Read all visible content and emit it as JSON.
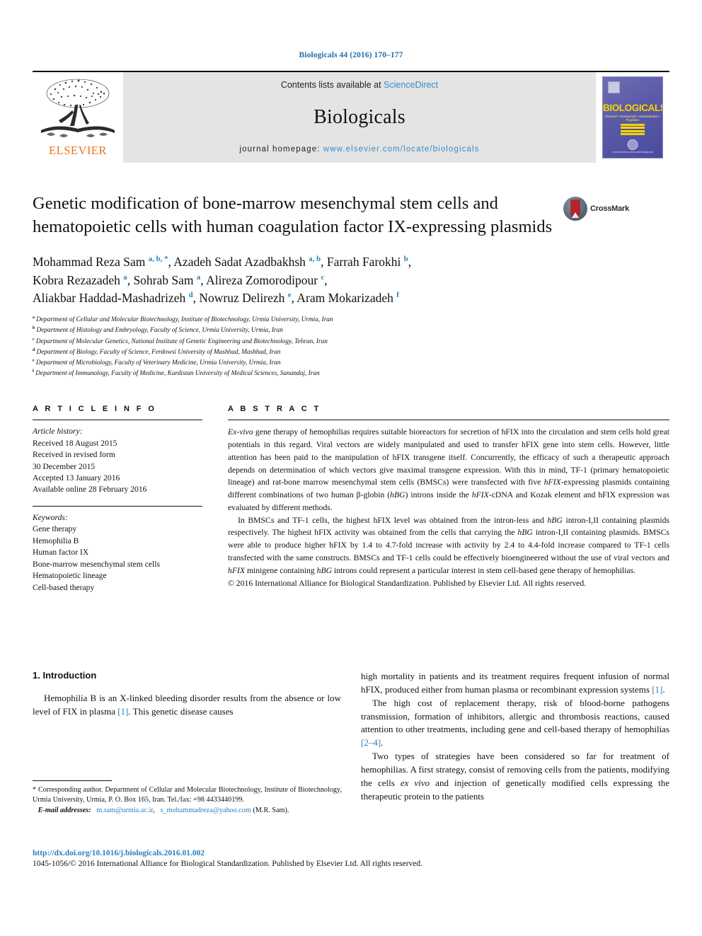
{
  "running_head": "Biologicals 44 (2016) 170–177",
  "masthead": {
    "contents_prefix": "Contents lists available at ",
    "contents_link": "ScienceDirect",
    "journal_name": "Biologicals",
    "homepage_prefix": "journal homepage: ",
    "homepage_url": "www.elsevier.com/locate/biologicals",
    "publisher": "ELSEVIER",
    "cover": {
      "title": "BIOLOGICALS",
      "subtitle": "Research • Development • Standardisation • Regulation",
      "footer": "www.elsevier.com/locate/biologicals"
    }
  },
  "article": {
    "title": "Genetic modification of bone-marrow mesenchymal stem cells and hematopoietic cells with human coagulation factor IX-expressing plasmids",
    "crossmark_label": "CrossMark",
    "authors_html": "Mohammad Reza Sam <sup>a, b, *</sup>, Azadeh Sadat Azadbakhsh <sup>a, b</sup>, Farrah Farokhi <sup>b</sup>,<br>Kobra Rezazadeh <sup>a</sup>, Sohrab Sam <sup>a</sup>, Alireza Zomorodipour <sup>c</sup>,<br>Aliakbar Haddad-Mashadrizeh <sup>d</sup>, Nowruz Delirezh <sup>e</sup>, Aram Mokarizadeh <sup>f</sup>",
    "affiliations": [
      {
        "mark": "a",
        "text": "Department of Cellular and Molecular Biotechnology, Institute of Biotechnology, Urmia University, Urmia, Iran"
      },
      {
        "mark": "b",
        "text": "Department of Histology and Embryology, Faculty of Science, Urmia University, Urmia, Iran"
      },
      {
        "mark": "c",
        "text": "Department of Molecular Genetics, National Institute of Genetic Engineering and Biotechnology, Tehran, Iran"
      },
      {
        "mark": "d",
        "text": "Department of Biology, Faculty of Science, Ferdowsi University of Mashhad, Mashhad, Iran"
      },
      {
        "mark": "e",
        "text": "Department of Microbiology, Faculty of Veterinary Medicine, Urmia University, Urmia, Iran"
      },
      {
        "mark": "f",
        "text": "Department of Immunology, Faculty of Medicine, Kurdistan University of Medical Sciences, Sanandaj, Iran"
      }
    ]
  },
  "article_info": {
    "heading": "A R T I C L E   I N F O",
    "history_label": "Article history:",
    "history": [
      "Received 18 August 2015",
      "Received in revised form",
      "30 December 2015",
      "Accepted 13 January 2016",
      "Available online 28 February 2016"
    ],
    "keywords_label": "Keywords:",
    "keywords": [
      "Gene therapy",
      "Hemophilia B",
      "Human factor IX",
      "Bone-marrow mesenchymal stem cells",
      "Hematopoietic lineage",
      "Cell-based therapy"
    ]
  },
  "abstract": {
    "heading": "A B S T R A C T",
    "paragraph1_html": "<i>Ex-vivo</i> gene therapy of hemophilias requires suitable bioreactors for secretion of hFIX into the circulation and stem cells hold great potentials in this regard. Viral vectors are widely manipulated and used to transfer hFIX gene into stem cells. However, little attention has been paid to the manipulation of hFIX transgene itself. Concurrently, the efficacy of such a therapeutic approach depends on determination of which vectors give maximal transgene expression. With this in mind, TF-1 (primary hematopoietic lineage) and rat-bone marrow mesenchymal stem cells (BMSCs) were transfected with five <i>hFIX</i>-expressing plasmids containing different combinations of two human β-globin (<i>hBG</i>) introns inside the <i>hFIX</i>-cDNA and Kozak element and hFIX expression was evaluated by different methods.",
    "paragraph2_html": "In BMSCs and TF-1 cells, the highest hFIX level was obtained from the intron-less and <i>hBG</i> intron-I,II containing plasmids respectively. The highest hFIX activity was obtained from the cells that carrying the <i>hBG</i> intron-I,II containing plasmids. BMSCs were able to produce higher hFIX by 1.4 to 4.7-fold increase with activity by 2.4 to 4.4-fold increase compared to TF-1 cells transfected with the same constructs. BMSCs and TF-1 cells could be effectively bioengineered without the use of viral vectors and <i>hFIX</i> minigene containing <i>hBG</i> introns could represent a particular interest in stem cell-based gene therapy of hemophilias.",
    "copyright": "© 2016 International Alliance for Biological Standardization. Published by Elsevier Ltd. All rights reserved."
  },
  "introduction": {
    "section_title": "1. Introduction",
    "left_paragraph_html": "Hemophilia B is an X-linked bleeding disorder results from the absence or low level of FIX in plasma <span class=\"ref\">[1]</span>. This genetic disease causes",
    "right_paragraph1_html": "high mortality in patients and its treatment requires frequent infusion of normal hFIX, produced either from human plasma or recombinant expression systems <span class=\"ref\">[1]</span>.",
    "right_paragraph2_html": "The high cost of replacement therapy, risk of blood-borne pathogens transmission, formation of inhibitors, allergic and thrombosis reactions, caused attention to other treatments, including gene and cell-based therapy of hemophilias <span class=\"ref\">[2–4]</span>.",
    "right_paragraph3_html": "Two types of strategies have been considered so far for treatment of hemophilias. A first strategy, consist of removing cells from the patients, modifying the cells <i>ex vivo</i> and injection of genetically modified cells expressing the therapeutic protein to the patients"
  },
  "footnote": {
    "corresponding_html": "* Corresponding author. Department of Cellular and Molecular Biotechnology, Institute of Biotechnology, Urmia University, Urmia, P. O. Box 165, Iran. Tel./fax: +98 4433440199.",
    "email_label": "E-mail addresses:",
    "email1": "m.sam@urmia.ac.ir",
    "email2": "s_mohammadreza@yahoo.com",
    "email_owner": "(M.R. Sam)."
  },
  "bottom": {
    "doi": "http://dx.doi.org/10.1016/j.biologicals.2016.01.002",
    "issn_line": "1045-1056/© 2016 International Alliance for Biological Standardization. Published by Elsevier Ltd. All rights reserved."
  },
  "colors": {
    "link_blue": "#2e7fb8",
    "elsevier_orange": "#e87722",
    "masthead_grey": "#e4e4e4",
    "crossmark_red": "#b2262a"
  }
}
